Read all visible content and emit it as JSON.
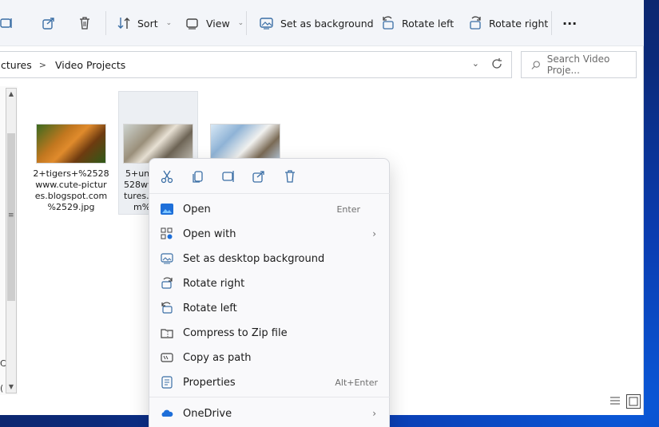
{
  "toolbar": {
    "sort_label": "Sort",
    "view_label": "View",
    "set_bg_label": "Set as background",
    "rotate_left_label": "Rotate left",
    "rotate_right_label": "Rotate right",
    "more_label": "···"
  },
  "address": {
    "crumb_parent": "ctures",
    "separator": ">",
    "crumb_current": "Video Projects"
  },
  "search": {
    "placeholder": "Search Video Proje..."
  },
  "nav_glyphs": {
    "g1": "C",
    "g2": "("
  },
  "files": [
    {
      "name_lines": [
        "2+tigers+%2528",
        "www.cute-pictur",
        "es.blogspot.com",
        "%2529.jpg"
      ]
    },
    {
      "name_lines": [
        "5+un",
        "528ww",
        "tures.l",
        "m%"
      ]
    },
    {
      "name_lines": []
    }
  ],
  "context_menu": {
    "items": [
      {
        "label": "Open",
        "shortcut": "Enter"
      },
      {
        "label": "Open with",
        "submenu": "›"
      },
      {
        "label": "Set as desktop background"
      },
      {
        "label": "Rotate right"
      },
      {
        "label": "Rotate left"
      },
      {
        "label": "Compress to Zip file"
      },
      {
        "label": "Copy as path"
      },
      {
        "label": "Properties",
        "shortcut": "Alt+Enter"
      },
      {
        "label": "OneDrive",
        "submenu": "›"
      }
    ]
  },
  "colors": {
    "accent": "#0a66c2",
    "onedrive": "#1e6fd9",
    "window_bg": "#ffffff",
    "menu_bg": "#f9f9fb"
  }
}
